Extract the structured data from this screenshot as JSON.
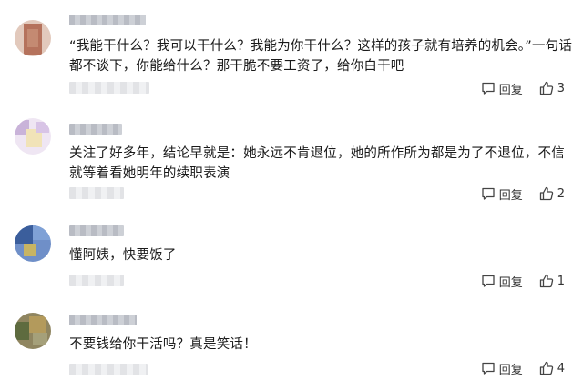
{
  "comments": [
    {
      "text": "“我能干什么？我可以干什么？我能为你干什么？这样的孩子就有培养的机会。”一句话都不谈下，你能给什么？那干脆不要工资了，给你白干吧",
      "reply_label": "回复",
      "like_count": "3",
      "avatar_colors": [
        "#d7a68f",
        "#c48a72",
        "#b5725c",
        "#e6c2ae"
      ]
    },
    {
      "text": "关注了好多年，结论早就是：她永远不肯退位，她的所作所为都是为了不退位，不信就等着看她明年的续职表演",
      "reply_label": "回复",
      "like_count": "2",
      "avatar_colors": [
        "#c9b3d9",
        "#e8d9a8",
        "#d8c4e6",
        "#f1e3b8"
      ]
    },
    {
      "text": "懂阿姨，快要饭了",
      "reply_label": "回复",
      "like_count": "1",
      "avatar_colors": [
        "#4a6fb0",
        "#7fa1d6",
        "#c8b463",
        "#3b5e9c"
      ]
    },
    {
      "text": "不要钱给你干活吗？真是笑话！",
      "reply_label": "回复",
      "like_count": "4",
      "avatar_colors": [
        "#8a7a52",
        "#b39a5c",
        "#5e6b3f",
        "#a5a07a"
      ]
    }
  ]
}
